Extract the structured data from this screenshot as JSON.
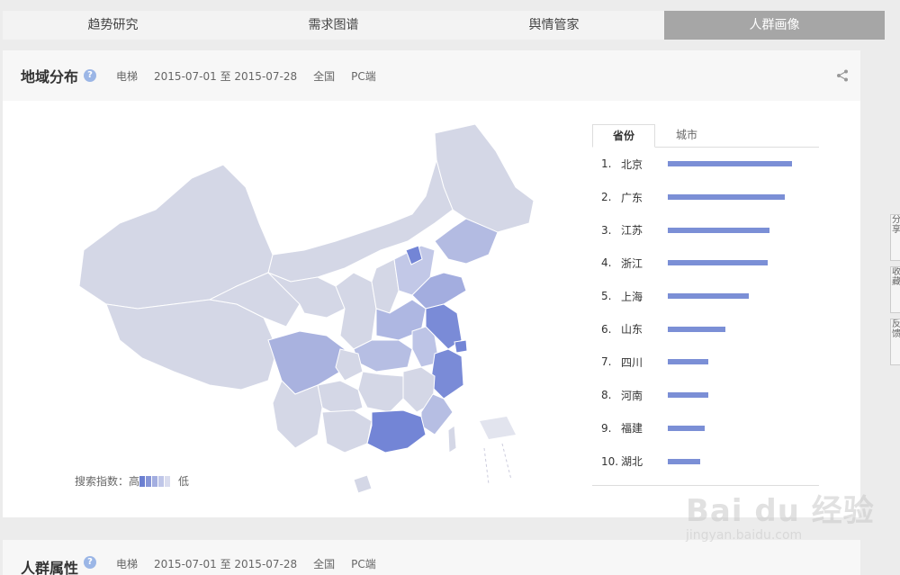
{
  "tabs": [
    "趋势研究",
    "需求图谱",
    "舆情管家",
    "人群画像"
  ],
  "active_tab": 3,
  "region": {
    "title": "地域分布",
    "keyword": "电梯",
    "date_range": "2015-07-01 至 2015-07-28",
    "area": "全国",
    "device": "PC端"
  },
  "legend": {
    "label": "搜索指数：高",
    "low": "低",
    "colors": [
      "#6b7fd1",
      "#8796d8",
      "#a3aee0",
      "#bfc6e8",
      "#d9dcee"
    ]
  },
  "rank_tabs": [
    "省份",
    "城市"
  ],
  "rank": [
    {
      "num": "1.",
      "name": "北京",
      "value": 138
    },
    {
      "num": "2.",
      "name": "广东",
      "value": 130
    },
    {
      "num": "3.",
      "name": "江苏",
      "value": 113
    },
    {
      "num": "4.",
      "name": "浙江",
      "value": 111
    },
    {
      "num": "5.",
      "name": "上海",
      "value": 90
    },
    {
      "num": "6.",
      "name": "山东",
      "value": 64
    },
    {
      "num": "7.",
      "name": "四川",
      "value": 45
    },
    {
      "num": "8.",
      "name": "河南",
      "value": 45
    },
    {
      "num": "9.",
      "name": "福建",
      "value": 41
    },
    {
      "num": "10.",
      "name": "湖北",
      "value": 36
    }
  ],
  "side_buttons": [
    "分享",
    "收藏",
    "反馈"
  ],
  "attr": {
    "title": "人群属性",
    "keyword": "电梯",
    "date_range": "2015-07-01 至 2015-07-28",
    "area": "全国",
    "device": "PC端"
  },
  "watermark": {
    "logo": "Bai du 经验",
    "url": "jingyan.baidu.com"
  },
  "colors": {
    "map_base": "#d4d7e6",
    "map_mid": "#a9b2df",
    "map_high": "#7385d6",
    "bar": "#7b8fd6"
  }
}
